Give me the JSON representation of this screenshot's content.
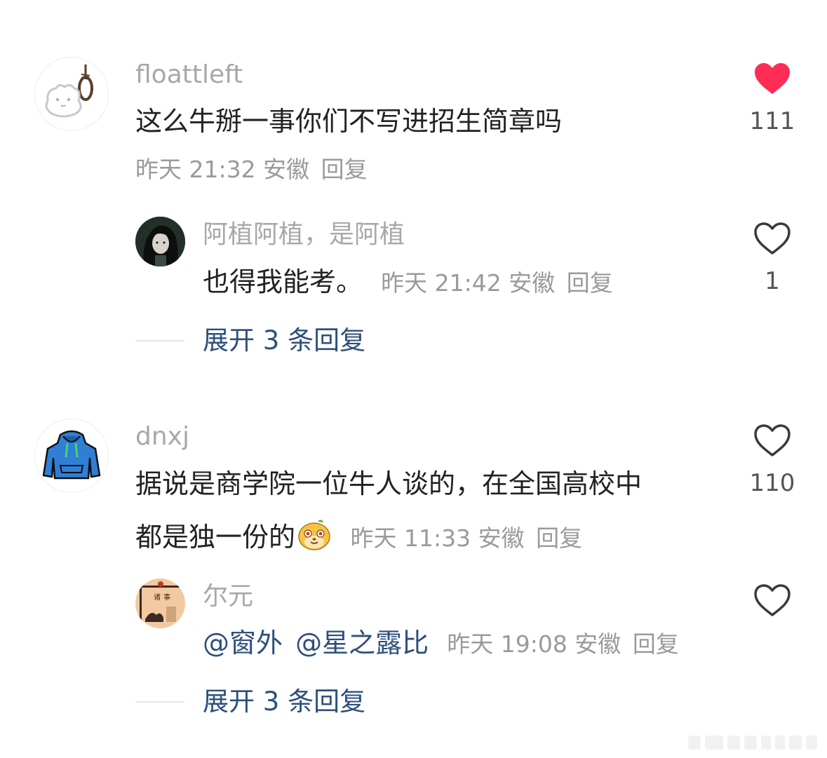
{
  "comments": [
    {
      "username": "floattleft",
      "content": "这么牛掰一事你们不写进招生简章吗",
      "time": "昨天 21:32",
      "location": "安徽",
      "reply_label": "回复",
      "likes": "111",
      "liked": true,
      "avatar_icon": "noose-cat-avatar",
      "sub_reply": {
        "username": "阿植阿植，是阿植",
        "content": "也得我能考。",
        "time": "昨天 21:42",
        "location": "安徽",
        "reply_label": "回复",
        "likes": "1",
        "avatar_icon": "dark-hair-girl-avatar"
      },
      "expand_label": "展开 3 条回复"
    },
    {
      "username": "dnxj",
      "content_line1": "据说是商学院一位牛人谈的，在全国高校中",
      "content_line2": "都是独一份的",
      "content_emoji": "smirk-face-emoji",
      "time": "昨天 11:33",
      "location": "安徽",
      "reply_label": "回复",
      "likes": "110",
      "liked": false,
      "avatar_icon": "blue-hoodie-avatar",
      "sub_reply": {
        "username": "尔元",
        "mention1": "@窗外",
        "mention2": "@星之露比",
        "time": "昨天 19:08",
        "location": "安徽",
        "reply_label": "回复",
        "likes": "",
        "avatar_icon": "ink-painting-avatar"
      },
      "expand_label": "展开 3 条回复"
    }
  ],
  "colors": {
    "liked_heart": "#ff2c55",
    "link_blue": "#2e4f7c",
    "meta_gray": "#9a9a9a"
  }
}
